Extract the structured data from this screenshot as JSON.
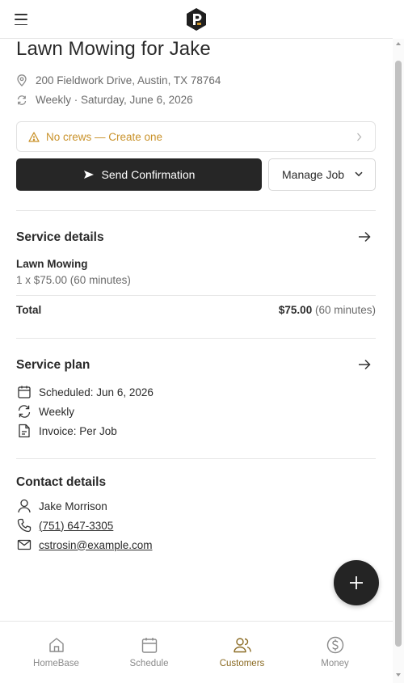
{
  "header": {
    "menu_icon": "hamburger-icon",
    "logo_icon": "brand-logo-icon"
  },
  "job": {
    "title": "Lawn Mowing for Jake",
    "address": "200 Fieldwork Drive, Austin, TX 78764",
    "schedule": "Weekly · Saturday, June 6, 2026"
  },
  "alert": {
    "text": "No crews — Create one",
    "color": "#c9922a"
  },
  "actions": {
    "send_label": "Send Confirmation",
    "manage_label": "Manage Job"
  },
  "service_details": {
    "title": "Service details",
    "item_name": "Lawn Mowing",
    "item_detail": "1 x $75.00 (60 minutes)",
    "total_label": "Total",
    "total_amount": "$75.00",
    "total_duration": "(60 minutes)"
  },
  "service_plan": {
    "title": "Service plan",
    "scheduled": "Scheduled: Jun 6, 2026",
    "frequency": "Weekly",
    "invoice": "Invoice: Per Job"
  },
  "contact": {
    "title": "Contact details",
    "name": "Jake Morrison",
    "phone": "(751) 647-3305",
    "email": "cstrosin@example.com"
  },
  "nav": {
    "items": [
      {
        "label": "HomeBase",
        "icon": "home-icon"
      },
      {
        "label": "Schedule",
        "icon": "calendar-icon"
      },
      {
        "label": "Customers",
        "icon": "users-icon"
      },
      {
        "label": "Money",
        "icon": "dollar-icon"
      }
    ],
    "active_color": "#8a6a22"
  },
  "colors": {
    "primary_button": "#262626",
    "accent": "#8a6a22"
  }
}
